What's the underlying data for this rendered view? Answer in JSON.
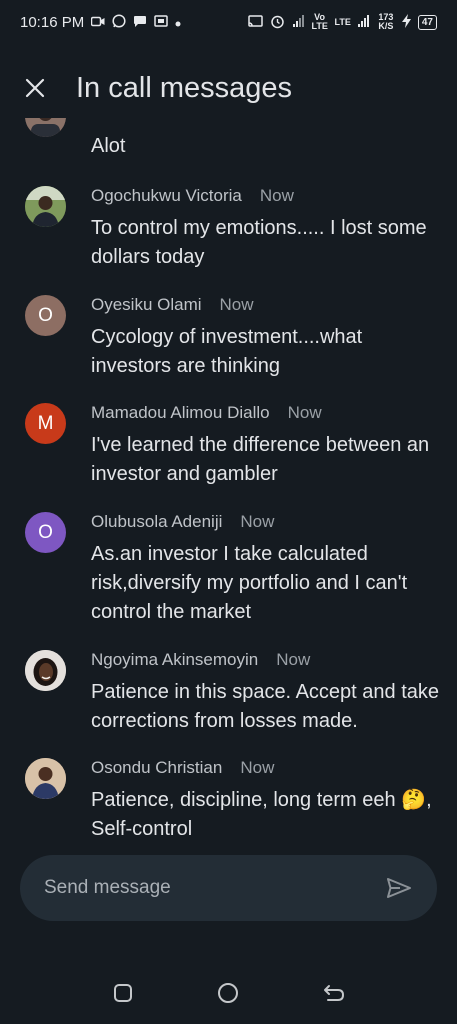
{
  "status_bar": {
    "time": "10:16 PM",
    "left_icons": [
      "video-icon",
      "whatsapp-icon",
      "chat-icon",
      "cast-icon",
      "dot-icon"
    ],
    "lte1": "Vo LTE",
    "lte2": "LTE",
    "speed": "173 K/S",
    "battery": "47"
  },
  "header": {
    "title": "In call messages"
  },
  "messages": [
    {
      "sender": "",
      "time": "",
      "text": "Alot",
      "avatar_type": "photo",
      "avatar_color": "#6b5a55"
    },
    {
      "sender": "Ogochukwu Victoria",
      "time": "Now",
      "text": "To control my emotions..... I lost some dollars today",
      "avatar_type": "photo",
      "avatar_color": "#4e6a3a"
    },
    {
      "sender": "Oyesiku Olami",
      "time": "Now",
      "text": "Cycology of investment....what investors are thinking",
      "avatar_type": "letter",
      "letter": "O",
      "avatar_color": "#8d6e63"
    },
    {
      "sender": "Mamadou Alimou Diallo",
      "time": "Now",
      "text": "I've learned the difference between an investor and gambler",
      "avatar_type": "letter",
      "letter": "M",
      "avatar_color": "#c83a1a"
    },
    {
      "sender": "Olubusola Adeniji",
      "time": "Now",
      "text": "As.an investor I take calculated risk,diversify my portfolio and I can't control the market",
      "avatar_type": "letter",
      "letter": "O",
      "avatar_color": "#7e57c2"
    },
    {
      "sender": "Ngoyima Akinsemoyin",
      "time": "Now",
      "text": "Patience in this space. Accept and take corrections from losses made.",
      "avatar_type": "photo",
      "avatar_color": "#d9d4cf"
    },
    {
      "sender": "Osondu Christian",
      "time": "Now",
      "text": "Patience, discipline, long term eeh 🤔, Self-control",
      "avatar_type": "photo",
      "avatar_color": "#c9a98a"
    }
  ],
  "composer": {
    "placeholder": "Send message"
  },
  "colors": {
    "background": "#151b21",
    "composer_bg": "#232d36",
    "text_primary": "#e3e5e8",
    "text_secondary": "#bfc3c8"
  }
}
